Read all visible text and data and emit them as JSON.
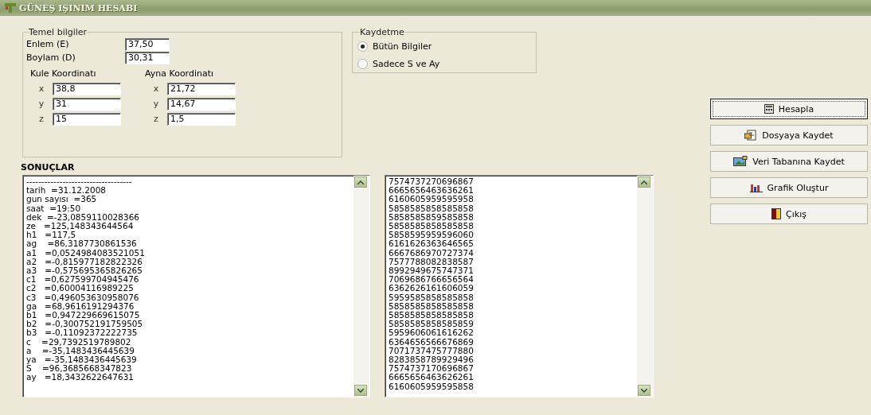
{
  "window": {
    "title": "GÜNEŞ IŞINIM HESABI"
  },
  "temel": {
    "title": "Temel bilgiler",
    "fields": [
      {
        "label": "Enlem (E)",
        "value": "37,50"
      },
      {
        "label": "Boylam (D)",
        "value": "30,31"
      }
    ],
    "groups": [
      {
        "title": "Kule Koordinatı",
        "fields": [
          {
            "label": "x",
            "value": "38,8"
          },
          {
            "label": "y",
            "value": "31"
          },
          {
            "label": "z",
            "value": "15"
          }
        ]
      },
      {
        "title": "Ayna Koordinatı",
        "fields": [
          {
            "label": "x",
            "value": "21,72"
          },
          {
            "label": "y",
            "value": "14,67"
          },
          {
            "label": "z",
            "value": "1,5"
          }
        ]
      }
    ]
  },
  "kaydetme": {
    "title": "Kaydetme",
    "options": [
      {
        "label": "Bütün Bilgiler",
        "selected": true
      },
      {
        "label": "Sadece S ve Ay",
        "selected": false
      }
    ]
  },
  "buttons": [
    {
      "label": "Hesapla",
      "kind": "calc",
      "focused": true
    },
    {
      "label": "Dosyaya Kaydet",
      "kind": "file",
      "focused": false
    },
    {
      "label": "Veri Tabanına Kaydet",
      "kind": "db",
      "focused": false
    },
    {
      "label": "Grafik Oluştur",
      "kind": "chart",
      "focused": false
    },
    {
      "label": "Çıkış",
      "kind": "exit",
      "focused": false
    }
  ],
  "results": {
    "title": "SONUÇLAR",
    "lines": [
      "-----------------------------------",
      "tarih  =31.12.2008",
      "gun sayısı  =365",
      "saat  =19:50",
      "dek  =-23,0859110028366",
      "ze   =125,148343644564",
      "h1   =117,5",
      "ag    =86,3187730861536",
      "a1   =0,0524984083521051",
      "a2   =-0,815977182822326",
      "a3   =-0,575695365826265",
      "c1   =0,627599704945476",
      "c2   =0,60004116989225",
      "c3   =0,496053630958076",
      "ga   =68,9616191294376",
      "b1   =0,947229669615075",
      "b2   =-0,300752191759505",
      "b3   =-0,11092372222735",
      "c    =29,7392519789802",
      "a    =-35,1483436445639",
      "ya   =-35,1483436445639",
      "S    =96,3685668347823",
      "ay   =18,3432622647631"
    ]
  },
  "numbers": {
    "lines": [
      "7574737270696867",
      "6665656463636261",
      "6160605959595958",
      "5858585858585858",
      "5858585859585858",
      "5858585858585858",
      "5858595959596060",
      "6161626363646565",
      "6667686970727374",
      "7577788082838587",
      "8992949675747371",
      "7069686766656564",
      "6362626161606059",
      "5959585858585858",
      "5858585858585858",
      "5858585858585858",
      "5858585858585859",
      "5959606061616262",
      "6364656566676869",
      "7071737475777880",
      "8283858789929496",
      "7574737170696867",
      "6665656463626261",
      "6160605959595858"
    ]
  }
}
